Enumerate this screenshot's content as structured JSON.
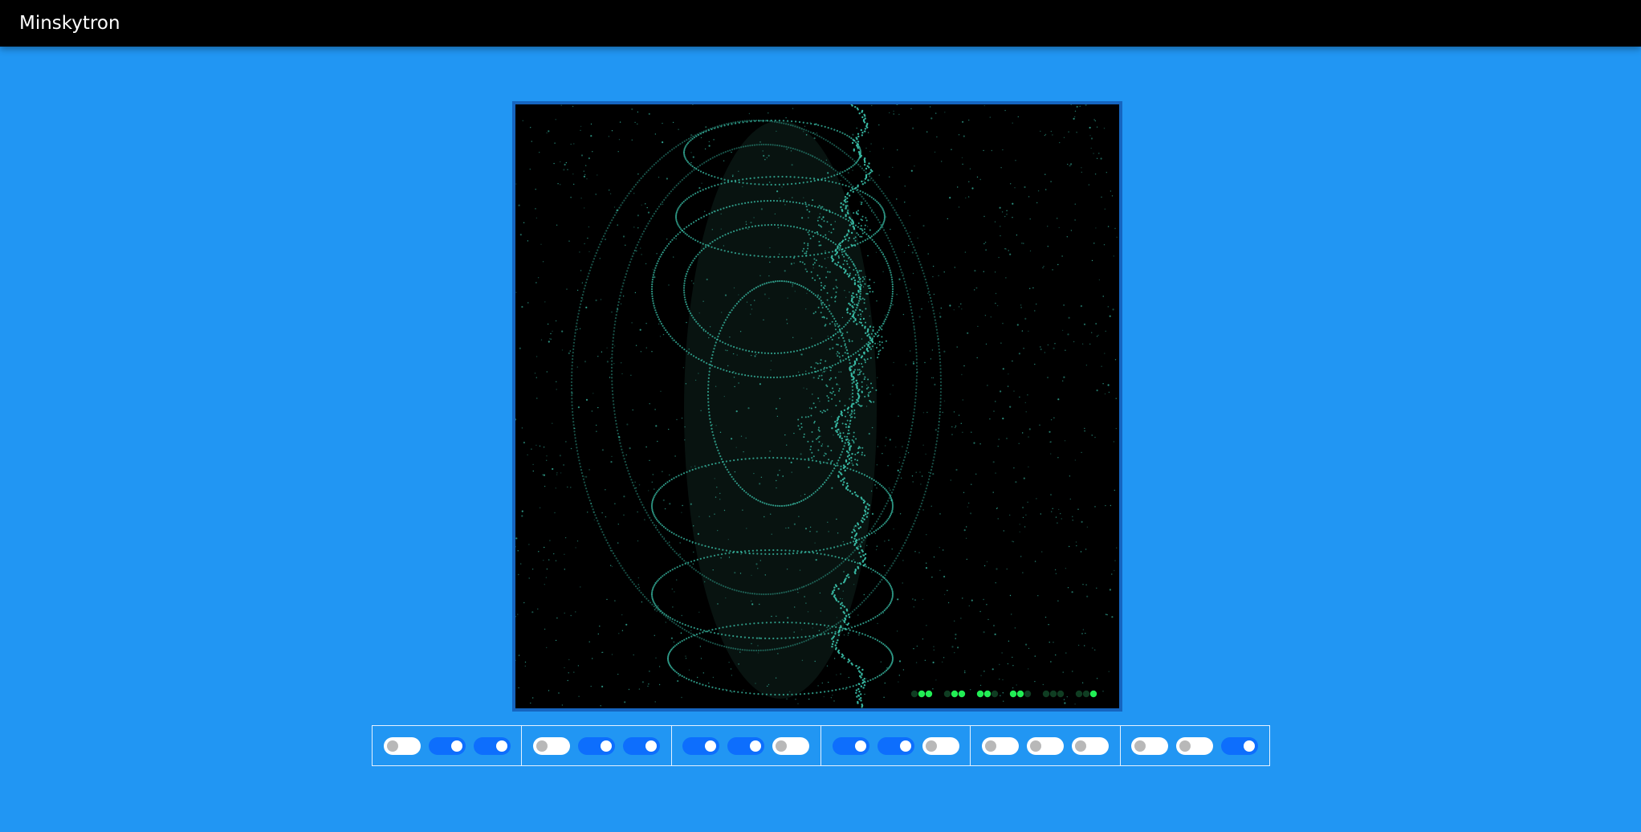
{
  "app": {
    "title": "Minskytron"
  },
  "display": {
    "background": "#000000",
    "trace_color": "#3fd1b8",
    "lamp_on_color": "#22ee55",
    "lamp_off_color": "#0f3d22",
    "lamp_groups": [
      [
        0,
        1,
        1
      ],
      [
        0,
        1,
        1
      ],
      [
        1,
        1,
        0
      ],
      [
        1,
        1,
        0
      ],
      [
        0,
        0,
        0
      ],
      [
        0,
        0,
        1
      ]
    ]
  },
  "switches": {
    "on_color": "#0d6efd",
    "off_color": "#ffffff",
    "groups": [
      [
        false,
        true,
        true
      ],
      [
        false,
        true,
        true
      ],
      [
        true,
        true,
        false
      ],
      [
        true,
        true,
        false
      ],
      [
        false,
        false,
        false
      ],
      [
        false,
        false,
        true
      ]
    ]
  }
}
